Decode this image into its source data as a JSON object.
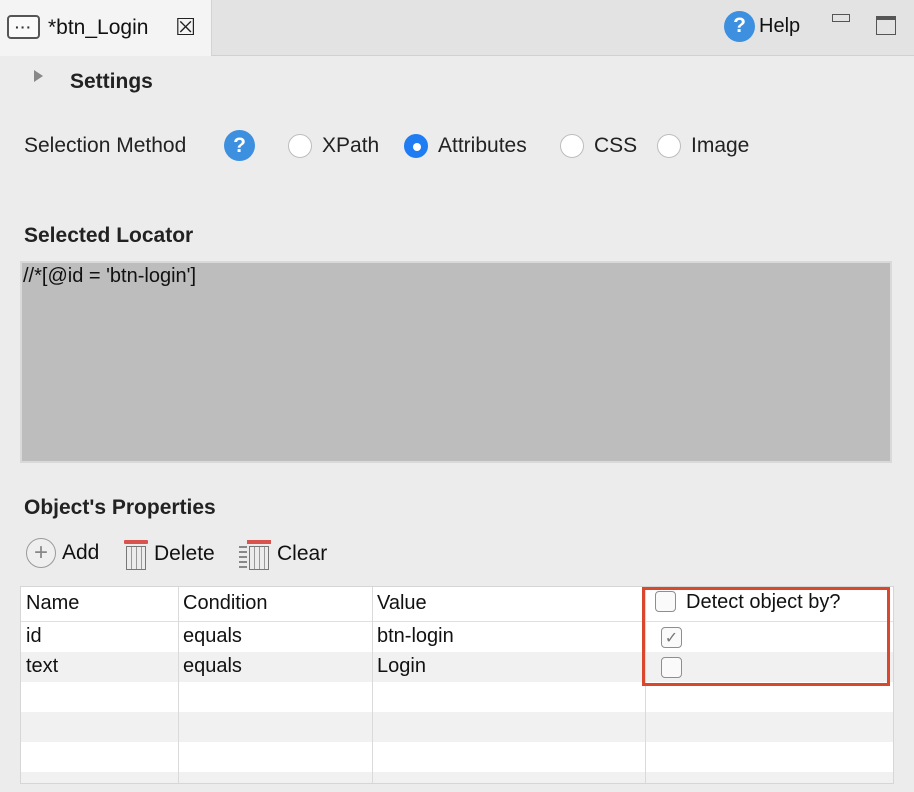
{
  "tab": {
    "title": "*btn_Login",
    "menu_icon": "ellipsis-icon",
    "close_icon": "close-icon"
  },
  "window": {
    "help_label": "Help",
    "help_icon": "help-question-icon"
  },
  "settings": {
    "label": "Settings"
  },
  "selection_method": {
    "label": "Selection Method",
    "help_icon": "help-question-icon",
    "options": [
      {
        "label": "XPath",
        "selected": false
      },
      {
        "label": "Attributes",
        "selected": true
      },
      {
        "label": "CSS",
        "selected": false
      },
      {
        "label": "Image",
        "selected": false
      }
    ]
  },
  "selected_locator": {
    "title": "Selected Locator",
    "value": "//*[@id = 'btn-login']"
  },
  "properties": {
    "title": "Object's Properties",
    "toolbar": {
      "add": "Add",
      "delete": "Delete",
      "clear": "Clear"
    },
    "columns": {
      "name": "Name",
      "condition": "Condition",
      "value": "Value",
      "detect": "Detect object by?"
    },
    "rows": [
      {
        "name": "id",
        "condition": "equals",
        "value": "btn-login",
        "detect": true
      },
      {
        "name": "text",
        "condition": "equals",
        "value": "Login",
        "detect": false
      }
    ]
  },
  "colors": {
    "accent": "#1f7cf3",
    "help": "#3d8fe0",
    "highlight": "#d9482c",
    "locator_bg": "#bdbdbd"
  }
}
